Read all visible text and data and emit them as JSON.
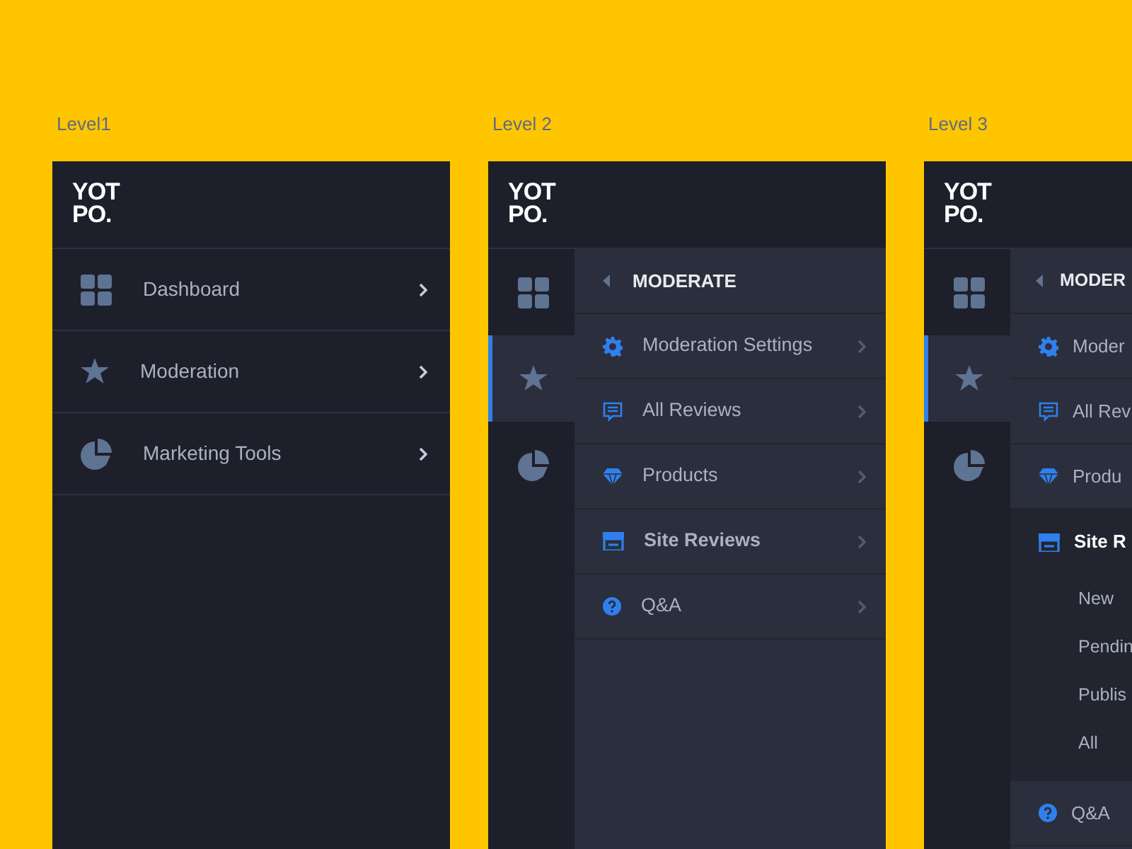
{
  "panels": [
    {
      "label": "Level1",
      "kind": "full",
      "logo": [
        "YOT",
        "PO."
      ],
      "menu": [
        {
          "label": "Dashboard"
        },
        {
          "label": "Moderation"
        },
        {
          "label": "Marketing Tools"
        }
      ]
    },
    {
      "label": "Level 2",
      "kind": "rail",
      "logo": [
        "YOT",
        "PO."
      ],
      "rail": [
        {
          "selected": false
        },
        {
          "selected": true
        },
        {
          "selected": false
        }
      ],
      "submenu": {
        "title": "MODERATE",
        "items": [
          {
            "label": "Moderation Settings",
            "selected": false,
            "expanded": false
          },
          {
            "label": "All Reviews",
            "selected": false,
            "expanded": false
          },
          {
            "label": "Products",
            "selected": false,
            "expanded": false
          },
          {
            "label": "Site Reviews",
            "selected": true,
            "expanded": false
          },
          {
            "label": "Q&A",
            "selected": false,
            "expanded": false
          }
        ]
      }
    },
    {
      "label": "Level 3",
      "kind": "rail",
      "logo": [
        "YOT",
        "PO."
      ],
      "rail": [
        {
          "selected": false
        },
        {
          "selected": true
        },
        {
          "selected": false
        }
      ],
      "submenu": {
        "title": "MODER",
        "items": [
          {
            "label": "Moder",
            "selected": false,
            "expanded": false
          },
          {
            "label": "All Rev",
            "selected": false,
            "expanded": false
          },
          {
            "label": "Produ",
            "selected": false,
            "expanded": false
          },
          {
            "label": "Site R",
            "selected": true,
            "expanded": true,
            "children": [
              {
                "label": "New"
              },
              {
                "label": "Pendin"
              },
              {
                "label": "Publis"
              },
              {
                "label": "All"
              }
            ]
          },
          {
            "label": "Q&A",
            "selected": false,
            "expanded": false
          }
        ]
      }
    }
  ]
}
